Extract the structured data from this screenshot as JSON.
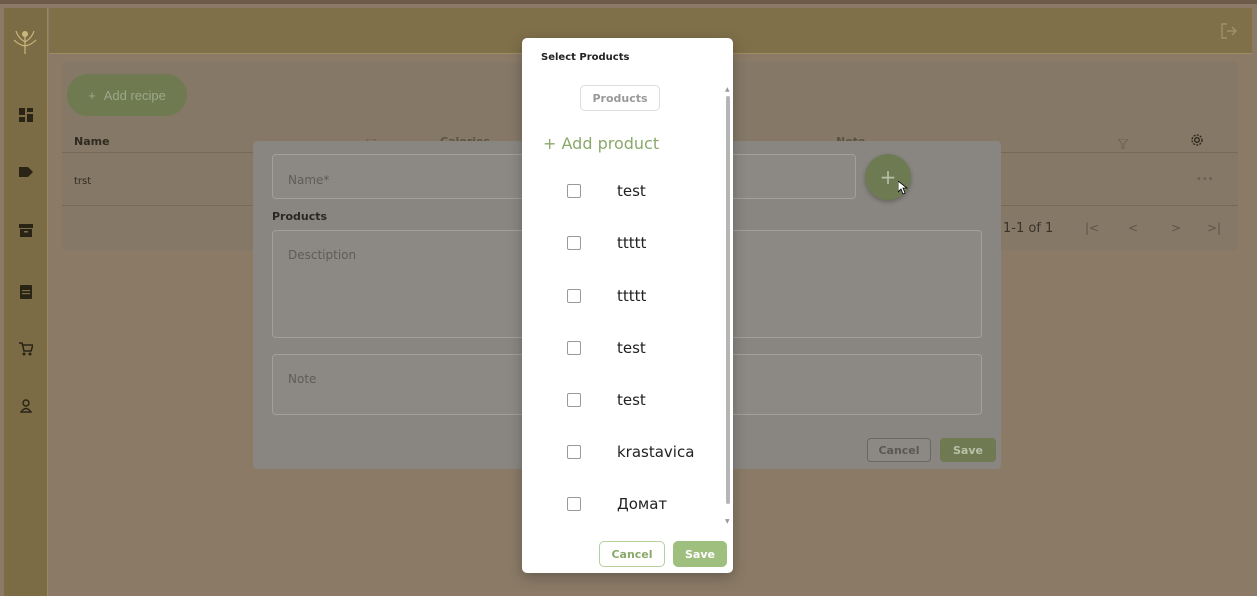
{
  "background": {
    "recipe_table": {
      "add_recipe_label": "Add recipe",
      "columns": [
        "Name",
        "Calories",
        "Note"
      ],
      "rows": [
        {
          "name": "trst",
          "actions": "•••"
        }
      ],
      "pagination": {
        "range": "1-1 of 1",
        "first": "|<",
        "prev": "<",
        "next": ">",
        "last": ">|"
      }
    },
    "recipe_dialog": {
      "name_label": "Name*",
      "products_label": "Products",
      "description_label": "Desctiption",
      "note_label": "Note",
      "cancel_label": "Cancel",
      "save_label": "Save",
      "fab_symbol": "+"
    }
  },
  "modal": {
    "title": "Select Products",
    "tab_label": "Products",
    "add_product_label": "Add product",
    "items": [
      {
        "label": "test",
        "checked": false
      },
      {
        "label": "ttttt",
        "checked": false
      },
      {
        "label": "ttttt",
        "checked": false
      },
      {
        "label": "test",
        "checked": false
      },
      {
        "label": "test",
        "checked": false
      },
      {
        "label": "krastavica",
        "checked": false
      },
      {
        "label": "Домат",
        "checked": false
      }
    ],
    "cancel_label": "Cancel",
    "save_label": "Save"
  },
  "colors": {
    "accent": "#8aa86a",
    "overlay_bg": "#8a7a66",
    "modal_bg": "#ffffff"
  },
  "icons": [
    "logo-icon",
    "dashboard-icon",
    "tag-icon",
    "archive-icon",
    "document-icon",
    "cart-icon",
    "user-icon",
    "logout-icon",
    "filter-icon",
    "settings-icon",
    "plus-icon"
  ]
}
